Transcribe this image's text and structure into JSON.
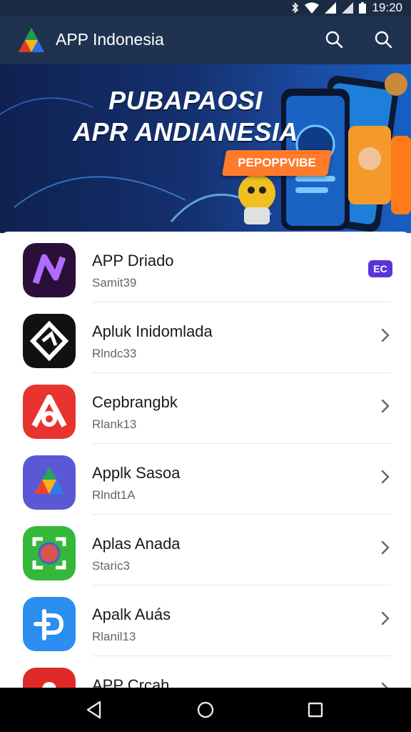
{
  "status_bar": {
    "time": "19:20",
    "icons": [
      "bluetooth-icon",
      "wifi-icon",
      "signal-icon",
      "signal-icon",
      "battery-icon"
    ]
  },
  "app_bar": {
    "title": "APP Indonesia",
    "actions": [
      "search-icon",
      "search-icon"
    ]
  },
  "banner": {
    "headline_1": "PUBAPAOSI",
    "headline_2": "APR ANDIANESIA",
    "button_label": "PEPOPPVIBE"
  },
  "apps": [
    {
      "name": "APP Driado",
      "subtitle": "Samit39",
      "icon": "app-n-icon",
      "color": "#2a1038",
      "badge": "EC"
    },
    {
      "name": "Apluk Inidomlada",
      "subtitle": "Rlndc33",
      "icon": "app-diamond-icon",
      "color": "#111111"
    },
    {
      "name": "Cepbrangbk",
      "subtitle": "Rlank13",
      "icon": "app-a-icon",
      "color": "#e8332e"
    },
    {
      "name": "Applk Sasoa",
      "subtitle": "Rlndt1A",
      "icon": "app-drive-icon",
      "color": "#5a58d4"
    },
    {
      "name": "Aplas Anada",
      "subtitle": "Staric3",
      "icon": "app-camera-icon",
      "color": "#34b83a"
    },
    {
      "name": "Apalk  Auás",
      "subtitle": "Rlanil13",
      "icon": "app-p-icon",
      "color": "#2b8ef0"
    },
    {
      "name": "APP Crcah",
      "subtitle": "",
      "icon": "app-red-icon",
      "color": "#e02a2a"
    }
  ],
  "nav_bar": {
    "buttons": [
      "back-icon",
      "home-icon",
      "recents-icon"
    ]
  },
  "colors": {
    "status_bar": "#1b2b44",
    "app_bar": "#1f3350",
    "accent_orange": "#ff7a2a",
    "badge": "#5a35d6"
  }
}
